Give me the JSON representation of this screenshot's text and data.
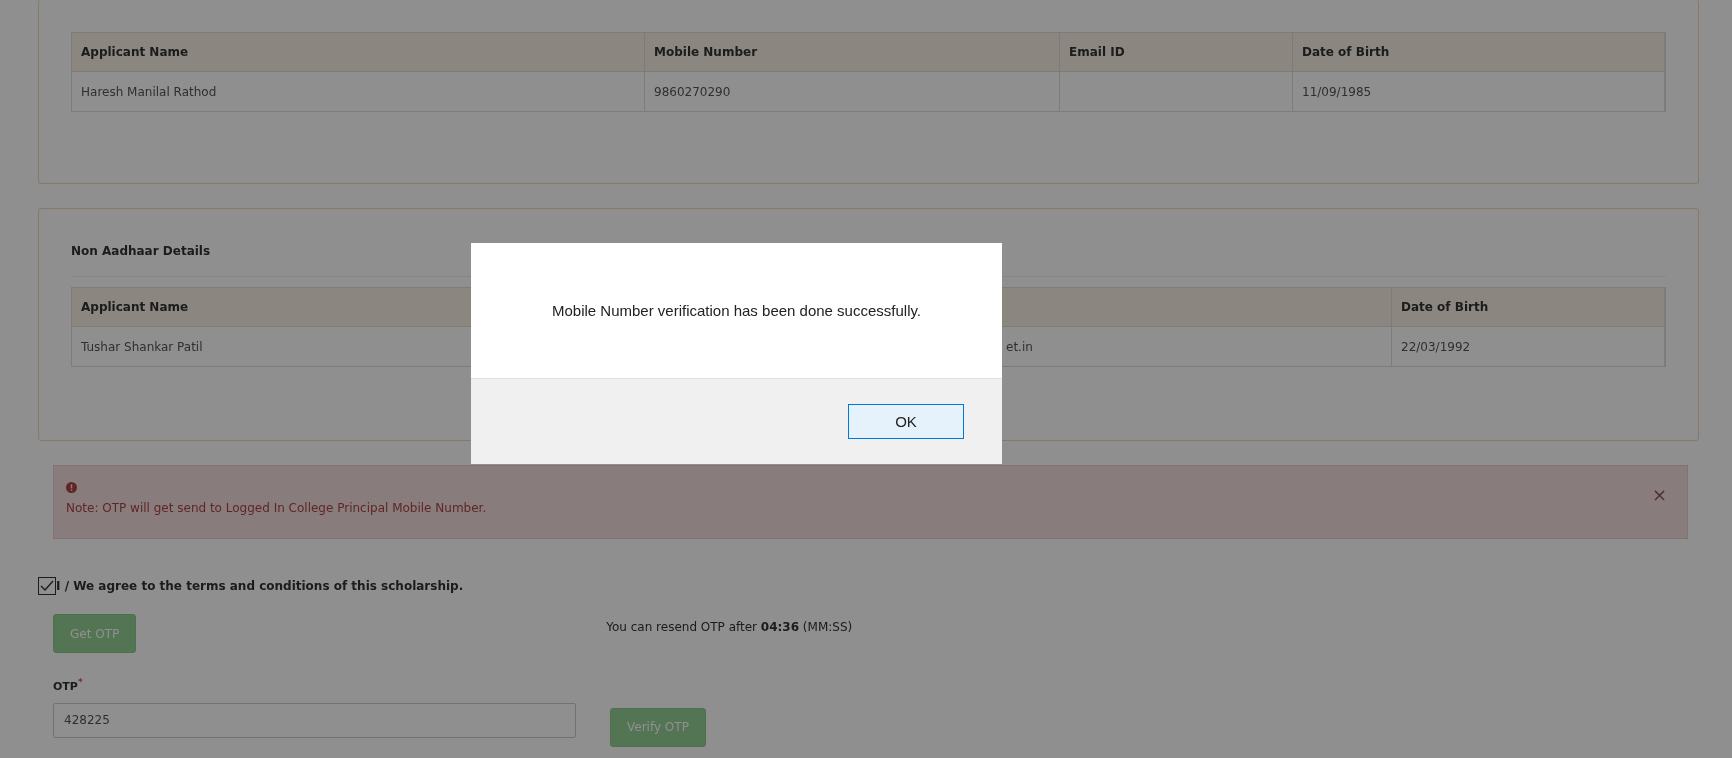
{
  "applicant_table": {
    "columns": [
      "Applicant Name",
      "Mobile Number",
      "Email ID",
      "Date of Birth"
    ],
    "rows": [
      [
        "Haresh Manilal Rathod",
        "9860270290",
        null,
        "11/09/1985"
      ]
    ]
  },
  "non_aadhaar_details": {
    "title": "Non Aadhaar Details",
    "columns": [
      "Applicant Name",
      null,
      null,
      "Date of Birth"
    ],
    "rows": [
      [
        "Tushar Shankar Patil",
        null,
        "et.in",
        "22/03/1992"
      ]
    ]
  },
  "alert": {
    "text": "Note: OTP will get send to Logged In College Principal Mobile Number.",
    "close": "×"
  },
  "agreement": {
    "checked": true,
    "label": "I / We agree to the terms and conditions of this scholarship."
  },
  "get_otp_button": {
    "label": "Get OTP",
    "disabled": true
  },
  "resend_note": "You can resend OTP after **04:36** (MM:SS)",
  "otp_field": {
    "label": "OTP",
    "required_mark": "*",
    "value": "428225"
  },
  "verify_otp_button": {
    "label": "Verify OTP",
    "disabled": true
  },
  "dialog": {
    "message": "Mobile Number verification has been done successfully.",
    "button": "OK"
  }
}
